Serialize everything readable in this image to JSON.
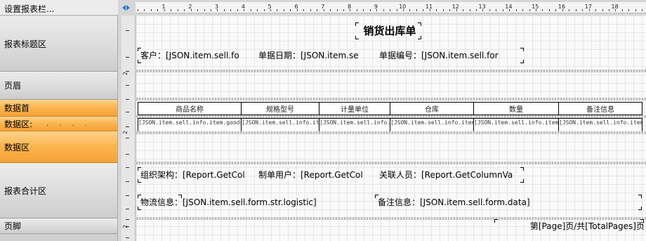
{
  "panel": {
    "header": "设置报表栏...",
    "bands": [
      {
        "label": "报表标题区"
      },
      {
        "label": "页眉"
      },
      {
        "label": "数据首"
      },
      {
        "label": "数据区:",
        "dots": ". . . ."
      },
      {
        "label": "数据区"
      },
      {
        "label": "报表合计区"
      },
      {
        "label": "页脚"
      }
    ]
  },
  "ruler": {
    "h_numbers": [
      "1",
      "2",
      "3",
      "4",
      "5",
      "6",
      "7",
      "8",
      "9",
      "10",
      "11",
      "12",
      "13",
      "14",
      "15",
      "16",
      "17",
      "18"
    ],
    "v_numbers": [
      "2",
      "2",
      "2"
    ]
  },
  "report": {
    "title": "销货出库单",
    "header_fields": {
      "customer": "客户：[JSON.item.sell.fo",
      "date": "单据日期：[JSON.item.se",
      "number": "单据编号：[JSON.item.sell.for"
    },
    "table_headers": [
      "商品名称",
      "规格型号",
      "计量单位",
      "仓库",
      "数量",
      "备注信息"
    ],
    "table_cells": [
      "[JSON.item.sell.info.item.goods_data.name]",
      "[JSON.item.sell.info.item.str.spec]",
      "[JSON.item.sell.info.item.str.cell",
      "[JSON.item.sell.info.item.warehouse_data.n",
      "[JSON.item.sell.info.item.nums]",
      "[JSON.item.sell.info.item.data]"
    ],
    "summary_fields": {
      "org": "组织架构：[Report.GetCol",
      "maker": "制单用户：[Report.GetCol",
      "related": "关联人员：[Report.GetColumnVa",
      "logistic": "物流信息：[JSON.item.sell.form.str.logistic]",
      "remark": "备注信息：[JSON.item.sell.form.data]"
    },
    "footer": {
      "page": "第[Page]页/共[TotalPages]页"
    }
  }
}
